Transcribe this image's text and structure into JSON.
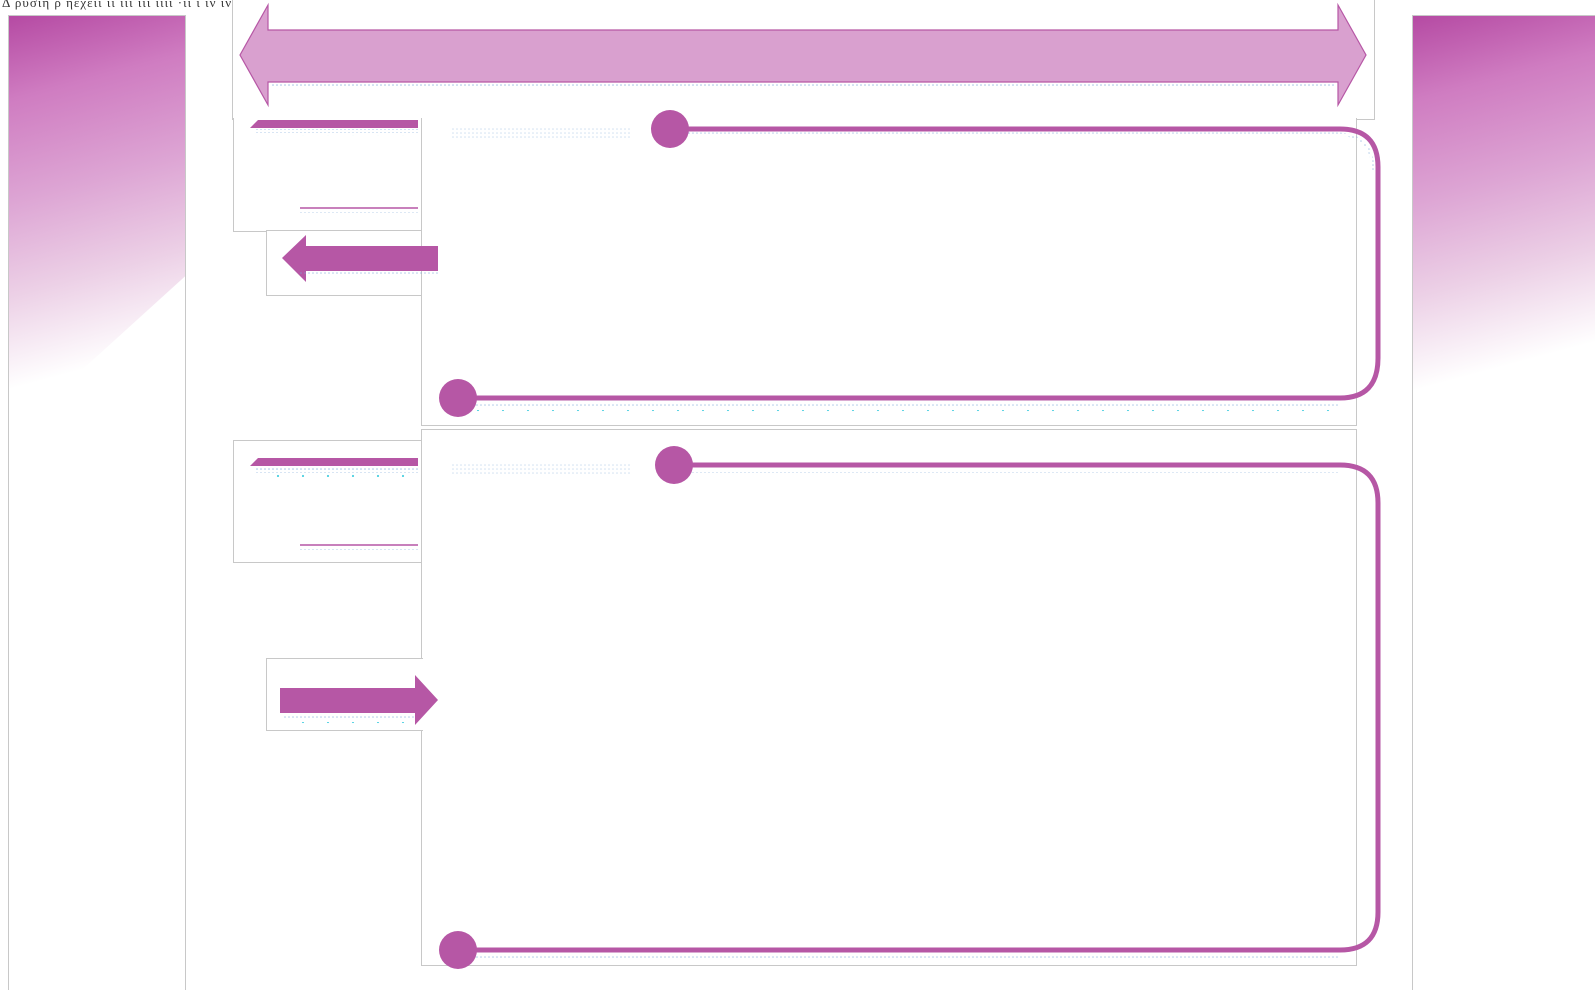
{
  "header": {
    "note": "Δ ρυσιη ρ ηεχειι   ιι ιιι ιιι ιιιι  ·ιι ι ιν ιν ιν  ιν"
  },
  "colors": {
    "accent": "#b657a5",
    "accent_light": "#d9a0cf",
    "frame_border": "#c8c8c8",
    "dot_blue": "#6fa8dc",
    "dot_cyan": "#4dd0e1"
  },
  "sections": [
    {
      "id": "step-1",
      "direction": "left"
    },
    {
      "id": "step-2",
      "direction": "right"
    }
  ]
}
